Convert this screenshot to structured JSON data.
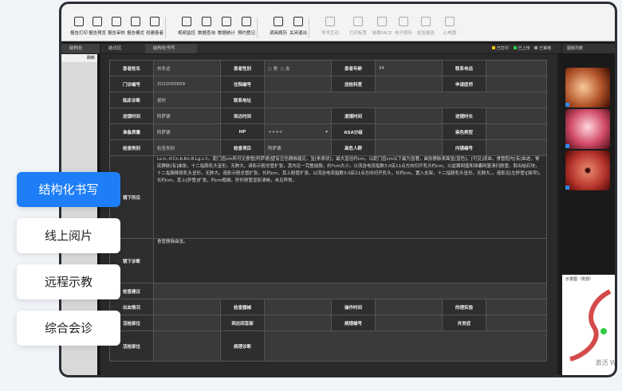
{
  "toolbar": {
    "items": [
      {
        "label": "报告打印",
        "dim": false
      },
      {
        "label": "报告预览",
        "dim": false
      },
      {
        "label": "报告审核",
        "dim": false
      },
      {
        "label": "报告模式",
        "dim": false
      },
      {
        "label": "创建患者",
        "dim": false
      },
      {
        "label": "视频监控",
        "dim": false
      },
      {
        "label": "数据查询",
        "dim": false
      },
      {
        "label": "数据统计",
        "dim": false
      },
      {
        "label": "预约登记",
        "dim": false
      },
      {
        "label": "调阅病历",
        "dim": false
      },
      {
        "label": "关闭退出",
        "dim": false
      },
      {
        "label": "学术互动",
        "dim": true
      },
      {
        "label": "打印标签",
        "dim": true
      },
      {
        "label": "装载FACE",
        "dim": true
      },
      {
        "label": "电子病历",
        "dim": true
      },
      {
        "label": "检验报告",
        "dim": true
      },
      {
        "label": "心电图",
        "dim": true
      }
    ]
  },
  "tabs": {
    "left": "结构化",
    "center1": "结诊区",
    "center2": "结构化书写"
  },
  "leftpanel": {
    "refresh": "刷新"
  },
  "legend": {
    "printed": "已打印",
    "sent": "已上传",
    "audited": "已审核"
  },
  "form": {
    "name_label": "患者姓名",
    "name_value": "刘冬运",
    "sex_label": "患者性别",
    "male": "男",
    "female": "女",
    "age_label": "患者年龄",
    "age_value": "34",
    "phone_label": "联系电话",
    "clinic_label": "门诊编号",
    "clinic_value": "2022050609",
    "hosp_label": "住院编号",
    "dept_label": "送检科室",
    "doctor_label": "申请医师",
    "diag_label": "临床诊断",
    "diag_value": "按时",
    "addr_label": "联系地址",
    "inspect_time_label": "进镜时间",
    "inspect_time_value": "阿萨德",
    "arrive_time_label": "到达时间",
    "exit_time_label": "退镜时间",
    "duration_label": "进镜时长",
    "prep_label": "准备质量",
    "prep_value": "阿萨德",
    "hp_label": "HP",
    "hp_value": "++++",
    "asa_label": "ASA分级",
    "dye_label": "染色类型",
    "exam_label": "检查类别",
    "exam_value": "检查类别",
    "item_label": "检查项目",
    "item_value": "阿萨德",
    "high_risk_label": "高危人群",
    "scope_label": "内镜编号",
    "findings_label": "镜下所见",
    "findings_text": "Ls.n..if.Cn.b.Kn.8.Lg.c.f.。距门齿cm所可见食管[阿萨德]壁有豆色静脉瘤见，呈[条索状]，最大直径约cm，以距门齿cm以下最为显著，曲张静脉表面呈[蓝色]，[可见]凌血，食管腔内[有]血迹，胃底静脉[有]曲张，十二指肠乳头呈形，无肿大。请影示胆总管扩张，其内见一完整结肠，约*cm大小，以流含电流指数3.0店11点方向切开乳头约cm，以盆属网篮和球囊网篮清扫胆管，取出结石块，十二指肠降段乳头呈形，无肿大。造影示胆总管扩张，长约cm，其上胆管扩张，以流含电流指数3.0店11点方向切开乳头，长约cm，置入支架，十二指肠乳头呈形，无肿大。。造影见[左肝管][狭窄]，长约cm，其上[肝管]扩张，约cm粗细，肝外胆管显影清晰，未见异常。",
    "conclusion_label": "镜下诊断",
    "conclusion_text": "食管静脉曲张。",
    "suggest_label": "检查建议",
    "bleed_label": "出血情况",
    "device_label": "检查器械",
    "op_time_label": "操作时间",
    "lab_label": "的理实验",
    "biopsy_label": "活检部位",
    "biopsy_count_label": "病理编号",
    "bbs_label": "到达回盲部",
    "complication_label": "并发症",
    "pathology_label": "病理诊断"
  },
  "right": {
    "tab": "图像列表",
    "diagram_label": "示意图（胃部）",
    "watermark": "激活 Wi"
  },
  "side_menu": [
    "结构化书写",
    "线上阅片",
    "远程示教",
    "综合会诊"
  ]
}
